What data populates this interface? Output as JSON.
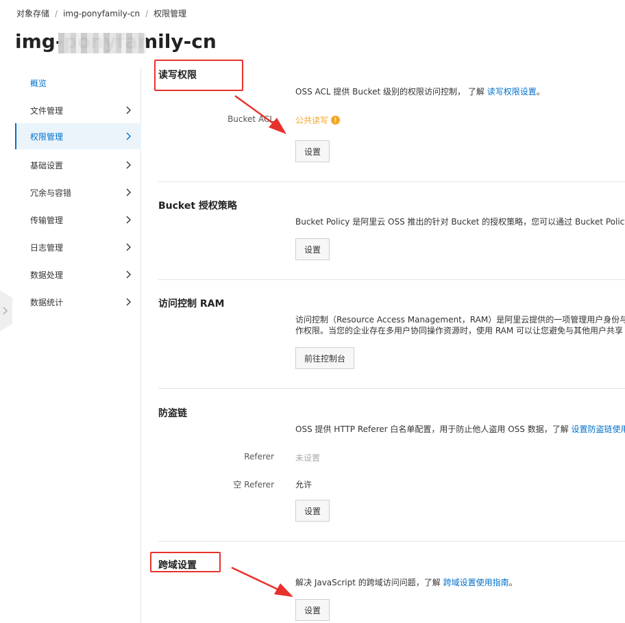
{
  "breadcrumb": {
    "items": [
      "对象存储",
      "img-ponyfamily-cn",
      "权限管理"
    ],
    "separator": "/"
  },
  "page_title": "img-ponyfamily-cn",
  "sidebar": {
    "items": [
      {
        "label": "概览"
      },
      {
        "label": "文件管理"
      },
      {
        "label": "权限管理"
      },
      {
        "label": "基础设置"
      },
      {
        "label": "冗余与容错"
      },
      {
        "label": "传输管理"
      },
      {
        "label": "日志管理"
      },
      {
        "label": "数据处理"
      },
      {
        "label": "数据统计"
      }
    ],
    "active": "权限管理"
  },
  "sections": {
    "acl": {
      "title": "读写权限",
      "desc_text": "OSS ACL 提供 Bucket 级别的权限访问控制， 了解 ",
      "desc_link": "读写权限设置",
      "desc_end": "。",
      "field_label": "Bucket ACL",
      "field_value": "公共读写",
      "warning_icon": "warning-circle-icon",
      "button": "设置"
    },
    "policy": {
      "title": "Bucket 授权策略",
      "desc_text": "Bucket Policy 是阿里云 OSS 推出的针对 Bucket 的授权策略，您可以通过 Bucket Policy 授",
      "button": "设置"
    },
    "ram": {
      "title": "访问控制 RAM",
      "desc_line1": "访问控制（Resource Access Management，RAM）是阿里云提供的一项管理用户身份与资",
      "desc_line2": "作权限。当您的企业存在多用户协同操作资源时，使用 RAM 可以让您避免与其他用户共享",
      "button": "前往控制台"
    },
    "referer": {
      "title": "防盗链",
      "desc_text": "OSS 提供 HTTP Referer 白名单配置，用于防止他人盗用 OSS 数据，了解 ",
      "desc_link": "设置防盗链使用",
      "referer_label": "Referer",
      "referer_value": "未设置",
      "empty_referer_label": "空 Referer",
      "empty_referer_value": "允许",
      "button": "设置"
    },
    "cors": {
      "title": "跨域设置",
      "desc_text": "解决 JavaScript 的跨域访问问题，了解 ",
      "desc_link": "跨域设置使用指南",
      "desc_end": "。",
      "button": "设置"
    }
  },
  "colors": {
    "link": "#0070cc",
    "warning": "#f5a623",
    "annotation_red": "#e8312b",
    "active_bg": "#ebf4fb"
  }
}
